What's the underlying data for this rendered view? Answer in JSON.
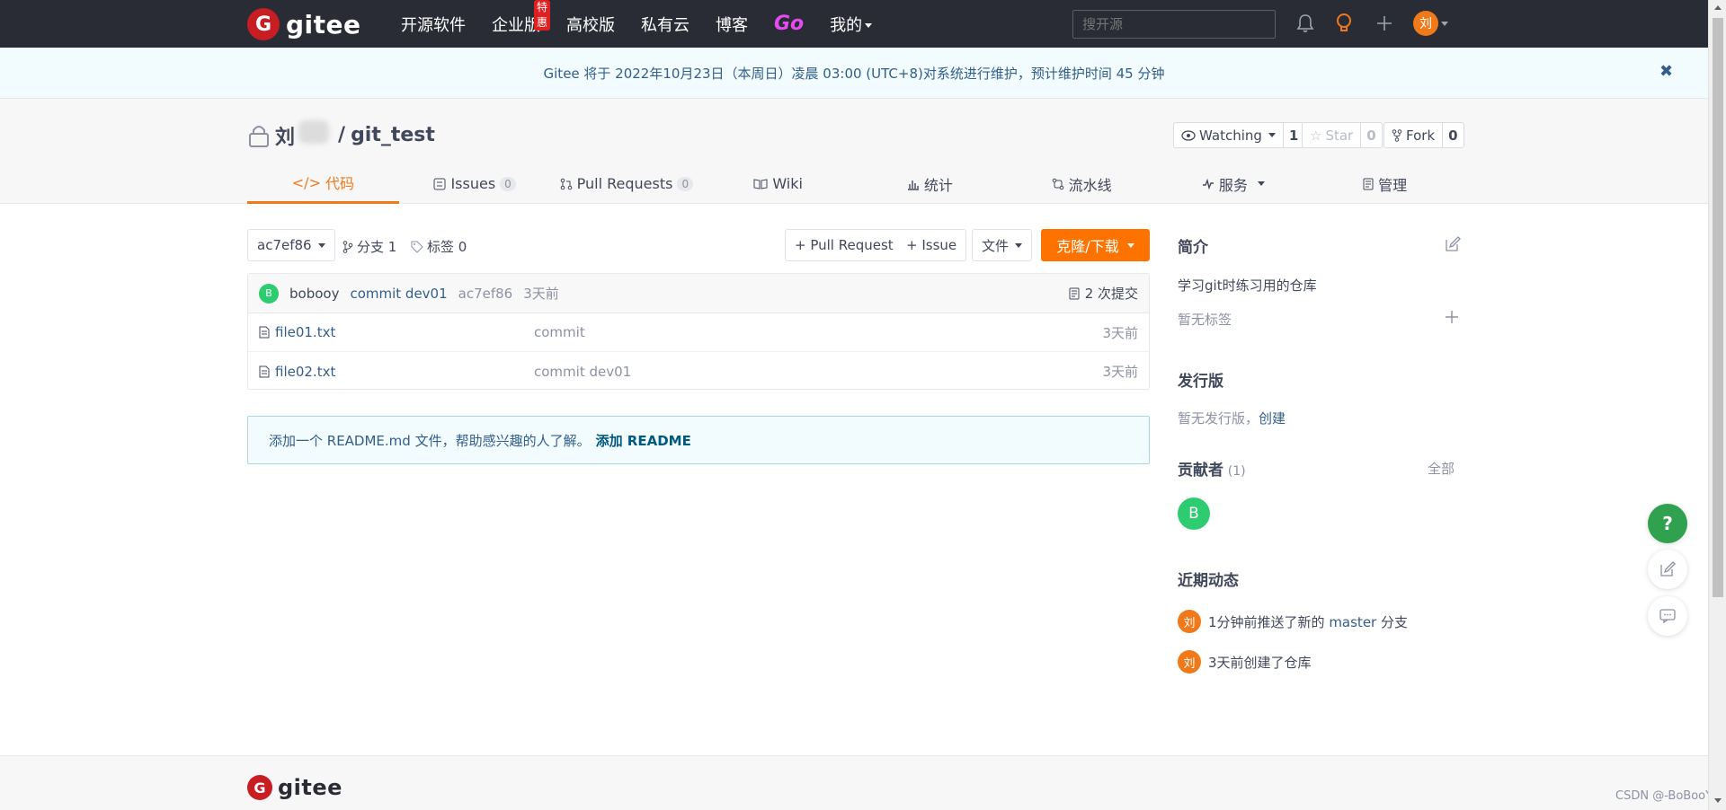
{
  "nav": {
    "logo_text": "gitee",
    "logo_letter": "G",
    "items": [
      "开源软件",
      "企业版",
      "高校版",
      "私有云",
      "博客"
    ],
    "badge": "特惠",
    "go": "Go",
    "mine": "我的",
    "search_placeholder": "搜开源",
    "avatar": "刘"
  },
  "notice": {
    "text": "Gitee 将于 2022年10月23日（本周日）凌晨 03:00 (UTC+8)对系统进行维护，预计维护时间 45 分钟",
    "close": "✖"
  },
  "repo": {
    "owner": "刘",
    "separator": "/",
    "name": "git_test",
    "watch_label": "Watching",
    "watch_count": "1",
    "star_label": "Star",
    "star_count": "0",
    "fork_label": "Fork",
    "fork_count": "0"
  },
  "tabs": [
    {
      "label": "代码"
    },
    {
      "label": "Issues",
      "count": "0"
    },
    {
      "label": "Pull Requests",
      "count": "0"
    },
    {
      "label": "Wiki"
    },
    {
      "label": "统计"
    },
    {
      "label": "流水线"
    },
    {
      "label": "服务"
    },
    {
      "label": "管理"
    }
  ],
  "toolbar": {
    "commit_select": "ac7ef86",
    "branches": "分支 1",
    "tags": "标签 0",
    "pull_request": "+ Pull Request",
    "issue": "+ Issue",
    "file": "文件",
    "clone": "克隆/下载"
  },
  "commit": {
    "avatar": "B",
    "author": "bobooy",
    "message": "commit dev01",
    "hash": "ac7ef86",
    "time": "3天前",
    "count": "2 次提交"
  },
  "files": [
    {
      "name": "file01.txt",
      "message": "commit",
      "time": "3天前"
    },
    {
      "name": "file02.txt",
      "message": "commit dev01",
      "time": "3天前"
    }
  ],
  "readme": {
    "text": "添加一个 README.md 文件，帮助感兴趣的人了解。",
    "link": "添加 README"
  },
  "sidebar": {
    "intro_title": "简介",
    "intro_text": "学习git时练习用的仓库",
    "no_tags": "暂无标签",
    "release_title": "发行版",
    "no_release": "暂无发行版，",
    "create": "创建",
    "contrib_title": "贡献者",
    "contrib_count": "(1)",
    "all": "全部",
    "contrib_avatar": "B",
    "activity_title": "近期动态",
    "activities": [
      {
        "avatar": "刘",
        "before": "1分钟前推送了新的 ",
        "link": "master",
        "after": " 分支"
      },
      {
        "avatar": "刘",
        "before": "3天前创建了仓库",
        "link": "",
        "after": ""
      }
    ]
  },
  "float": {
    "help": "?"
  },
  "footer": {
    "logo_text": "gitee",
    "logo_letter": "G"
  },
  "watermark": "CSDN @-BoBooY-"
}
